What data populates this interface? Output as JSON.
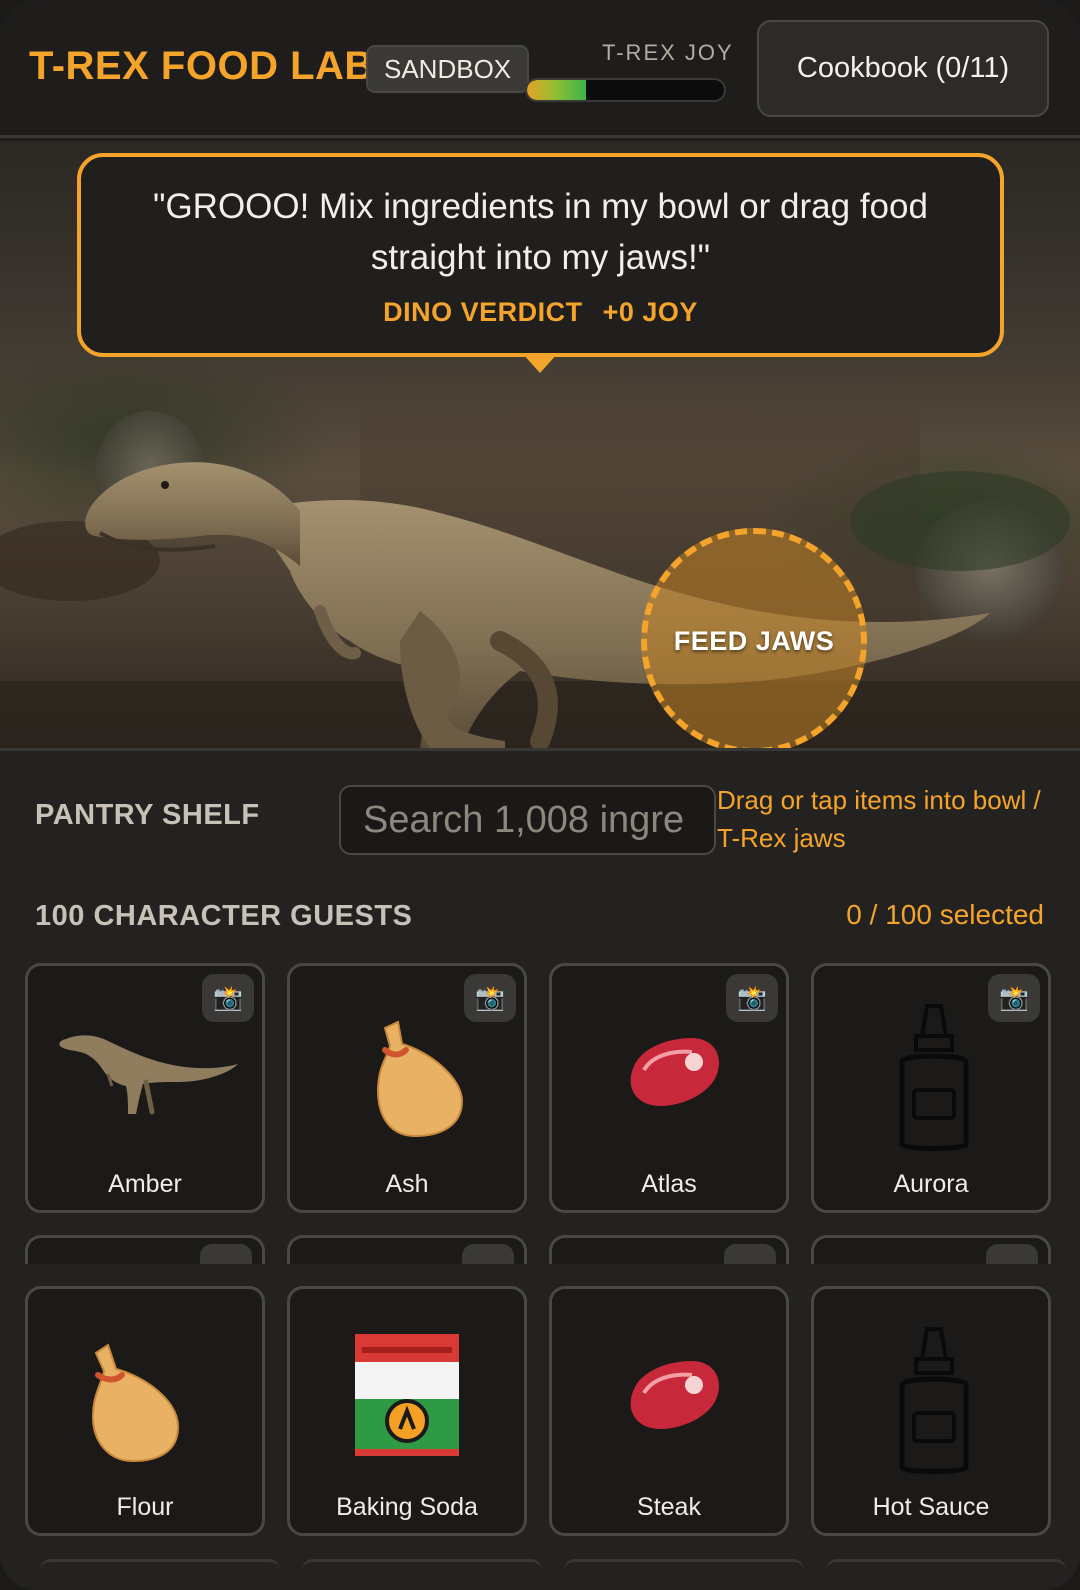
{
  "header": {
    "title": "T-REX FOOD LAB",
    "mode_badge": "SANDBOX",
    "joy_label": "T-REX JOY",
    "joy_level": 0.3,
    "cookbook_button": "Cookbook (0/11)"
  },
  "scene": {
    "speech": "\"GROOO! Mix ingredients in my bowl or drag food straight into my jaws!\"",
    "verdict_label": "DINO VERDICT",
    "verdict_value": "+0 JOY",
    "feed_zone_label": "FEED JAWS"
  },
  "pantry": {
    "title": "PANTRY SHELF",
    "search_placeholder": "Search 1,008 ingre",
    "hint": "Drag or tap items into bowl / T-Rex jaws",
    "guests_title": "100 CHARACTER GUESTS",
    "guests_selected": "0 / 100 selected",
    "guests": [
      {
        "name": "Amber",
        "icon": "t-rex-icon"
      },
      {
        "name": "Ash",
        "icon": "sack-icon"
      },
      {
        "name": "Atlas",
        "icon": "steak-icon"
      },
      {
        "name": "Aurora",
        "icon": "bottle-icon"
      }
    ],
    "ingredients": [
      {
        "name": "Flour",
        "icon": "flour-sack-icon"
      },
      {
        "name": "Baking Soda",
        "icon": "baking-soda-box-icon"
      },
      {
        "name": "Steak",
        "icon": "steak-icon"
      },
      {
        "name": "Hot Sauce",
        "icon": "hot-sauce-bottle-icon"
      }
    ],
    "camera_icon": "📸"
  },
  "colors": {
    "accent": "#f4a42a",
    "background": "#1f1e1c",
    "card": "#1b1a19",
    "border": "#4a4845"
  }
}
